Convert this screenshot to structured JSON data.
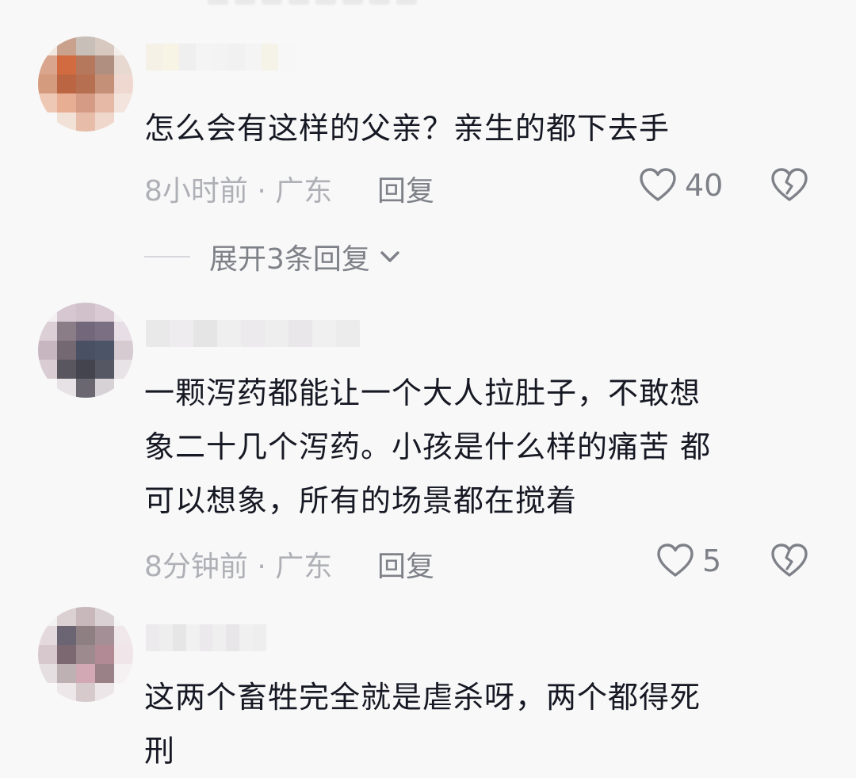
{
  "comments": [
    {
      "text": "怎么会有这样的父亲？亲生的都下去手",
      "time_location": "8小时前 · 广东",
      "reply_label": "回复",
      "likes": "40",
      "replies_expand": {
        "label": "展开3条回复"
      }
    },
    {
      "text_lines": [
        "一颗泻药都能让一个大人拉肚子，不敢想",
        "象二十几个泻药。小孩是什么样的痛苦 都",
        "可以想象，所有的场景都在搅着"
      ],
      "time_location": "8分钟前 · 广东",
      "reply_label": "回复",
      "likes": "5"
    },
    {
      "text_lines": [
        "这两个畜牲完全就是虐杀呀，两个都得死",
        "刑"
      ]
    }
  ],
  "icons": {
    "like": "heart-outline-icon",
    "dislike": "broken-heart-icon",
    "expand": "chevron-down-icon"
  },
  "colors": {
    "background": "#f8f8f8",
    "text": "#161823",
    "secondary": "#7f8189",
    "muted": "#aeb0b6"
  }
}
